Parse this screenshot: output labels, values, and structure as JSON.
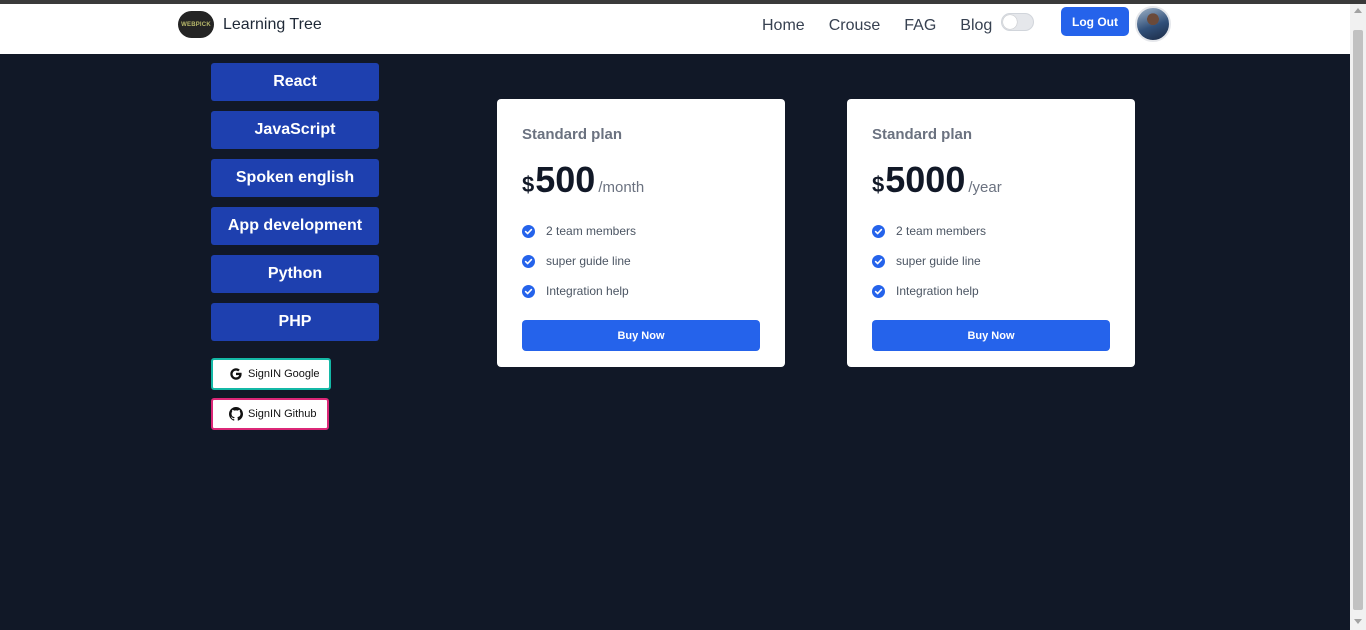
{
  "navbar": {
    "logo_text": "WEBPICK",
    "brand": "Learning Tree",
    "links": [
      "Home",
      "Crouse",
      "FAG",
      "Blog"
    ],
    "theme_toggle": "off",
    "logout_label": "Log Out"
  },
  "sidebar": {
    "courses": [
      "React",
      "JavaScript",
      "Spoken english",
      "App development",
      "Python",
      "PHP"
    ],
    "google_label": "SignIN Google",
    "github_label": "SignIN Github"
  },
  "plans": [
    {
      "name": "Standard plan",
      "currency": "$",
      "amount": "500",
      "period": "/month",
      "features": [
        "2 team members",
        "super guide line",
        "Integration help"
      ],
      "button": "Buy Now"
    },
    {
      "name": "Standard plan",
      "currency": "$",
      "amount": "5000",
      "period": "/year",
      "features": [
        "2 team members",
        "super guide line",
        "Integration help"
      ],
      "button": "Buy Now"
    }
  ],
  "colors": {
    "page_background": "#111827",
    "course_button": "#1e40af",
    "primary": "#2563eb",
    "google_border": "#14b8a6",
    "github_border": "#db2777"
  }
}
